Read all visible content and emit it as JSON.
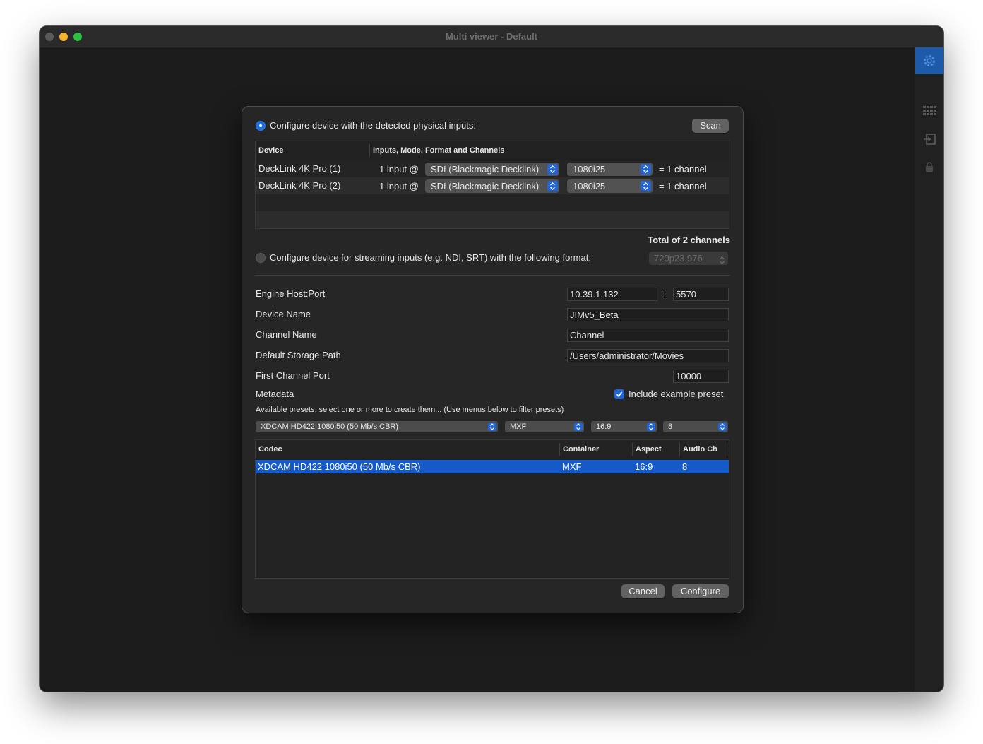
{
  "window": {
    "title": "Multi viewer - Default"
  },
  "sidebar": {
    "icons": [
      "gear-icon",
      "grid-icon",
      "input-icon",
      "lock-icon"
    ]
  },
  "dialog": {
    "physical_option": {
      "label": "Configure device with the detected physical inputs:",
      "selected": true
    },
    "scan_label": "Scan",
    "devices_table": {
      "headers": [
        "Device",
        "Inputs, Mode, Format and Channels"
      ],
      "rows": [
        {
          "device": "DeckLink 4K Pro (1)",
          "inputs": "1 input @",
          "mode": "SDI (Blackmagic Decklink)",
          "format": "1080i25",
          "channels": "= 1 channel"
        },
        {
          "device": "DeckLink 4K Pro (2)",
          "inputs": "1 input @",
          "mode": "SDI (Blackmagic Decklink)",
          "format": "1080i25",
          "channels": "= 1 channel"
        }
      ]
    },
    "total_label": "Total of 2 channels",
    "streaming_option": {
      "label": "Configure device for streaming inputs (e.g. NDI, SRT) with the following format:",
      "selected": false,
      "format": "720p23.976"
    },
    "engine_host_label": "Engine Host:Port",
    "engine_host_value": "10.39.1.132",
    "port_separator": ":",
    "engine_port_value": "5570",
    "device_name_label": "Device Name",
    "device_name_value": "JIMv5_Beta",
    "channel_name_label": "Channel Name",
    "channel_name_value": "Channel",
    "storage_path_label": "Default Storage Path",
    "storage_path_value": "/Users/administrator/Movies",
    "first_port_label": "First Channel Port",
    "first_port_value": "10000",
    "metadata_label": "Metadata",
    "include_preset_label": "Include example preset",
    "include_preset_checked": true,
    "presets_hint": "Available presets, select one or more to create them... (Use menus below to filter presets)",
    "filters": {
      "codec": "XDCAM HD422 1080i50 (50 Mb/s CBR)",
      "container": "MXF",
      "aspect": "16:9",
      "audio": "8"
    },
    "presets_table": {
      "headers": [
        "Codec",
        "Container",
        "Aspect",
        "Audio Ch"
      ],
      "rows": [
        {
          "codec": "XDCAM HD422 1080i50 (50 Mb/s CBR)",
          "container": "MXF",
          "aspect": "16:9",
          "audio": "8",
          "selected": true
        }
      ]
    },
    "cancel_label": "Cancel",
    "configure_label": "Configure"
  },
  "colors": {
    "accent": "#1f6fe0",
    "selection": "#1659c9",
    "dialog_bg": "#262626",
    "window_bg": "#1c1c1c"
  }
}
